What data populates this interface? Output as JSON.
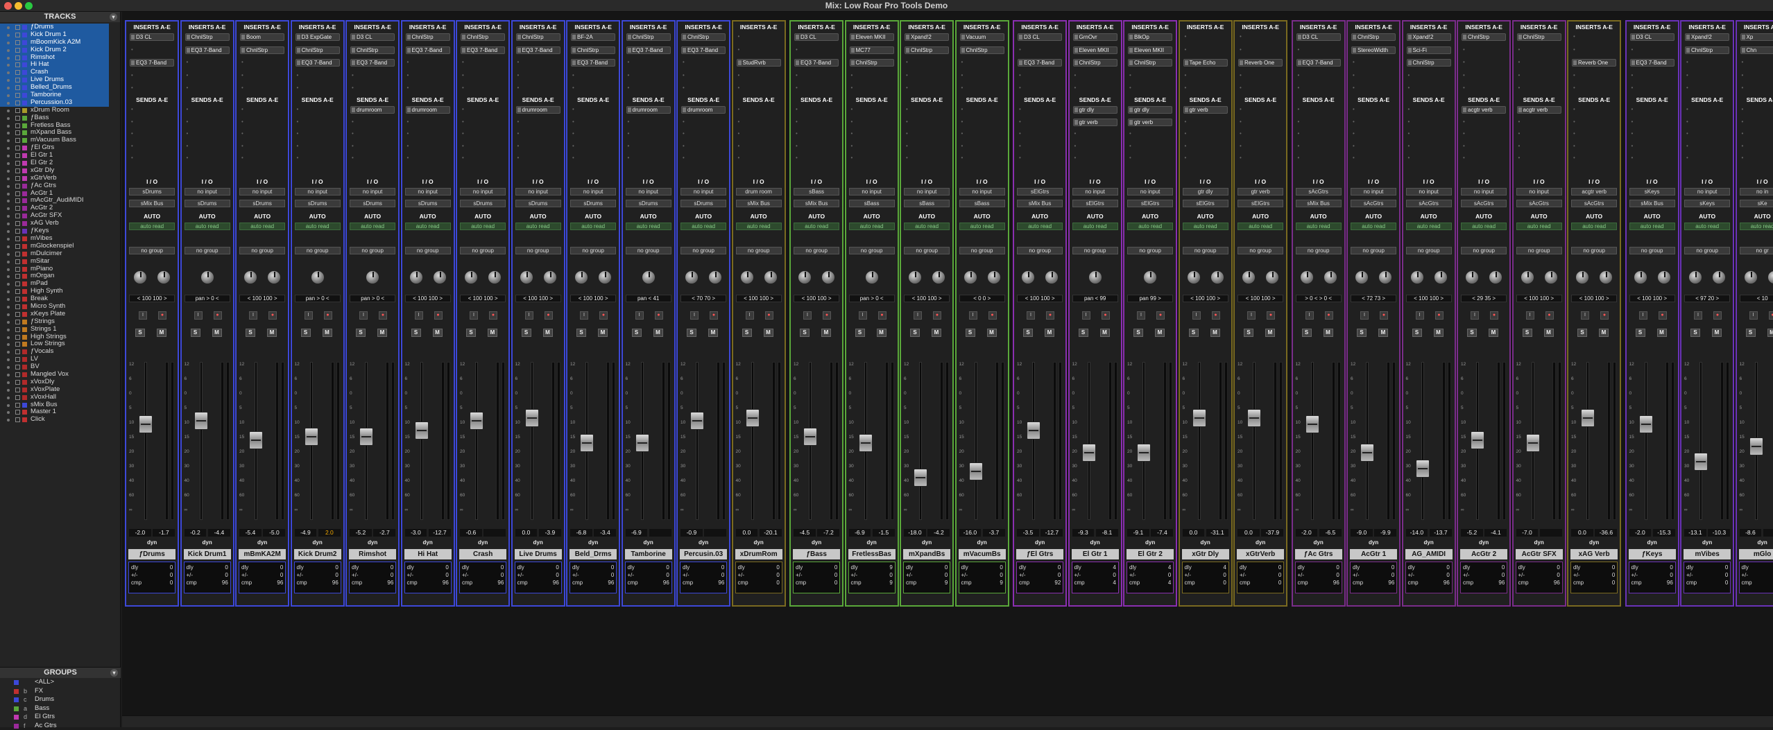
{
  "window": {
    "title": "Mix: Low Roar Pro Tools Demo"
  },
  "colors": {
    "drums": "#3d48d8",
    "bass": "#5aa83a",
    "elgtr": "#8a2fb0",
    "acgtr": "#7a2d8a",
    "keys": "#6a32b8",
    "aux": "#7a6a20",
    "teal": "#2a8a8a"
  },
  "sidebar": {
    "tracks_header": "TRACKS",
    "groups_header": "GROUPS",
    "tracks": [
      {
        "name": "ƒDrums",
        "color": "#3d48d8",
        "sel": true
      },
      {
        "name": "Kick Drum 1",
        "color": "#3d48d8",
        "sel": true
      },
      {
        "name": "mBoomKick A2M",
        "color": "#3d48d8",
        "sel": true
      },
      {
        "name": "Kick Drum 2",
        "color": "#3d48d8",
        "sel": true
      },
      {
        "name": "Rimshot",
        "color": "#3d48d8",
        "sel": true
      },
      {
        "name": "Hi Hat",
        "color": "#3d48d8",
        "sel": true
      },
      {
        "name": "Crash",
        "color": "#3d48d8",
        "sel": true
      },
      {
        "name": "Live Drums",
        "color": "#3d48d8",
        "sel": true
      },
      {
        "name": "Belled_Drums",
        "color": "#3d48d8",
        "sel": true
      },
      {
        "name": "Tamborine",
        "color": "#3d48d8",
        "sel": true
      },
      {
        "name": "Percussion.03",
        "color": "#3d48d8",
        "sel": true
      },
      {
        "name": "xDrum Room",
        "color": "#a89a2a",
        "sel": false
      },
      {
        "name": "ƒBass",
        "color": "#5aa83a",
        "sel": false
      },
      {
        "name": "Fretless Bass",
        "color": "#5aa83a",
        "sel": false
      },
      {
        "name": "mXpand Bass",
        "color": "#5aa83a",
        "sel": false
      },
      {
        "name": "mVacuum Bass",
        "color": "#5aa83a",
        "sel": false
      },
      {
        "name": "ƒEl Gtrs",
        "color": "#c03ab0",
        "sel": false
      },
      {
        "name": "El Gtr 1",
        "color": "#c03ab0",
        "sel": false
      },
      {
        "name": "El Gtr 2",
        "color": "#c03ab0",
        "sel": false
      },
      {
        "name": "xGtr Dly",
        "color": "#c03ab0",
        "sel": false
      },
      {
        "name": "xGtrVerb",
        "color": "#c03ab0",
        "sel": false
      },
      {
        "name": "ƒAc Gtrs",
        "color": "#9a2a9a",
        "sel": false
      },
      {
        "name": "AcGtr 1",
        "color": "#9a2a9a",
        "sel": false
      },
      {
        "name": "mAcGtr_AudiMIDI",
        "color": "#9a2a9a",
        "sel": false
      },
      {
        "name": "AcGtr 2",
        "color": "#9a2a9a",
        "sel": false
      },
      {
        "name": "AcGtr SFX",
        "color": "#9a2a9a",
        "sel": false
      },
      {
        "name": "xAG Verb",
        "color": "#9a2a9a",
        "sel": false
      },
      {
        "name": "ƒKeys",
        "color": "#6a32b8",
        "sel": false
      },
      {
        "name": "mVibes",
        "color": "#c03030",
        "sel": false
      },
      {
        "name": "mGlockenspiel",
        "color": "#c03030",
        "sel": false
      },
      {
        "name": "mDulcimer",
        "color": "#c03030",
        "sel": false
      },
      {
        "name": "mSitar",
        "color": "#c03030",
        "sel": false
      },
      {
        "name": "mPiano",
        "color": "#c03030",
        "sel": false
      },
      {
        "name": "mOrgan",
        "color": "#c03030",
        "sel": false
      },
      {
        "name": "mPad",
        "color": "#c03030",
        "sel": false
      },
      {
        "name": "High Synth",
        "color": "#c03030",
        "sel": false
      },
      {
        "name": "Break",
        "color": "#c03030",
        "sel": false
      },
      {
        "name": "Micro Synth",
        "color": "#c03030",
        "sel": false
      },
      {
        "name": "xKeys Plate",
        "color": "#c03030",
        "sel": false
      },
      {
        "name": "ƒStrings",
        "color": "#c07a20",
        "sel": false
      },
      {
        "name": "Strings 1",
        "color": "#c07a20",
        "sel": false
      },
      {
        "name": "High Strings",
        "color": "#c07a20",
        "sel": false
      },
      {
        "name": "Low Strings",
        "color": "#c07a20",
        "sel": false
      },
      {
        "name": "ƒVocals",
        "color": "#b02a2a",
        "sel": false
      },
      {
        "name": "LV",
        "color": "#b02a2a",
        "sel": false
      },
      {
        "name": "BV",
        "color": "#b02a2a",
        "sel": false
      },
      {
        "name": "Mangled Vox",
        "color": "#b02a2a",
        "sel": false
      },
      {
        "name": "xVoxDly",
        "color": "#b02a2a",
        "sel": false
      },
      {
        "name": "xVoxPlate",
        "color": "#b02a2a",
        "sel": false
      },
      {
        "name": "xVoxHall",
        "color": "#b02a2a",
        "sel": false
      },
      {
        "name": "sMix Bus",
        "color": "#3d48d8",
        "sel": false
      },
      {
        "name": "Master 1",
        "color": "#c03030",
        "sel": false
      },
      {
        "name": "Click",
        "color": "#c03030",
        "sel": false
      }
    ],
    "groups": [
      {
        "id": "",
        "name": "<ALL>",
        "color": "#3d48d8"
      },
      {
        "id": "b",
        "name": "FX",
        "color": "#c03030"
      },
      {
        "id": "c",
        "name": "Drums",
        "color": "#3d48d8"
      },
      {
        "id": "a",
        "name": "Bass",
        "color": "#5aa83a"
      },
      {
        "id": "d",
        "name": "El Gtrs",
        "color": "#c03ab0"
      },
      {
        "id": "f",
        "name": "Ac Gtrs",
        "color": "#9a2a9a"
      }
    ]
  },
  "strips": [
    {
      "name": "ƒDrums",
      "color": "#3d48d8",
      "ins": [
        "D3 CL",
        "",
        "EQ3 7-Band"
      ],
      "sends": [],
      "io_in": "sDrums",
      "io_out": "sMix Bus",
      "group": "no group",
      "pan": [
        "< 100",
        "100 >"
      ],
      "stereo": true,
      "vol": "-2.0",
      "peak": "-1.7",
      "fpos": 0.42,
      "dly": "0",
      "pm": "0",
      "cmp": "0"
    },
    {
      "name": "Kick Drum1",
      "color": "#3d48d8",
      "ins": [
        "ChnlStrp",
        "EQ3 7-Band",
        ""
      ],
      "sends": [],
      "io_in": "no input",
      "io_out": "sDrums",
      "group": "no group",
      "pan": [
        "pan",
        "> 0 <"
      ],
      "stereo": false,
      "vol": "-0.2",
      "peak": "-4.4",
      "fpos": 0.4,
      "dly": "0",
      "pm": "0",
      "cmp": "96"
    },
    {
      "name": "mBmKA2M",
      "color": "#3d48d8",
      "ins": [
        "Boom",
        "ChnlStrp",
        ""
      ],
      "sends": [],
      "io_in": "no input",
      "io_out": "sDrums",
      "group": "no group",
      "pan": [
        "< 100",
        "100 >"
      ],
      "stereo": true,
      "vol": "-5.4",
      "peak": "-5.0",
      "fpos": 0.52,
      "dly": "0",
      "pm": "0",
      "cmp": "96"
    },
    {
      "name": "Kick Drum2",
      "color": "#3d48d8",
      "ins": [
        "D3 ExpGate",
        "ChnlStrp",
        "EQ3 7-Band"
      ],
      "sends": [],
      "io_in": "no input",
      "io_out": "sDrums",
      "group": "no group",
      "pan": [
        "pan",
        "> 0 <"
      ],
      "stereo": false,
      "vol": "-4.9",
      "peak": "2.0",
      "fpos": 0.5,
      "dly": "0",
      "pm": "0",
      "cmp": "96"
    },
    {
      "name": "Rimshot",
      "color": "#3d48d8",
      "ins": [
        "D3 CL",
        "ChnlStrp",
        "EQ3 7-Band"
      ],
      "sends": [
        "drumroom"
      ],
      "io_in": "no input",
      "io_out": "sDrums",
      "group": "no group",
      "pan": [
        "pan",
        "> 0 <"
      ],
      "stereo": false,
      "vol": "-5.2",
      "peak": "-2.7",
      "fpos": 0.5,
      "dly": "0",
      "pm": "0",
      "cmp": "96"
    },
    {
      "name": "Hi Hat",
      "color": "#3d48d8",
      "ins": [
        "ChnlStrp",
        "EQ3 7-Band",
        ""
      ],
      "sends": [
        "drumroom"
      ],
      "io_in": "no input",
      "io_out": "sDrums",
      "group": "no group",
      "pan": [
        "< 100",
        "100 >"
      ],
      "stereo": true,
      "vol": "-3.0",
      "peak": "-12.7",
      "fpos": 0.46,
      "dly": "0",
      "pm": "0",
      "cmp": "96"
    },
    {
      "name": "Crash",
      "color": "#3d48d8",
      "ins": [
        "ChnlStrp",
        "EQ3 7-Band",
        ""
      ],
      "sends": [],
      "io_in": "no input",
      "io_out": "sDrums",
      "group": "no group",
      "pan": [
        "< 100",
        "100 >"
      ],
      "stereo": true,
      "vol": "-0.6",
      "peak": "",
      "fpos": 0.4,
      "dly": "0",
      "pm": "0",
      "cmp": "96"
    },
    {
      "name": "Live Drums",
      "color": "#3d48d8",
      "ins": [
        "ChnlStrp",
        "EQ3 7-Band",
        ""
      ],
      "sends": [
        "drumroom"
      ],
      "io_in": "no input",
      "io_out": "sDrums",
      "group": "no group",
      "pan": [
        "< 100",
        "100 >"
      ],
      "stereo": true,
      "vol": "0.0",
      "peak": "-3.9",
      "fpos": 0.38,
      "dly": "0",
      "pm": "0",
      "cmp": "96"
    },
    {
      "name": "Beld_Drms",
      "color": "#3d48d8",
      "ins": [
        "BF-2A",
        "ChnlStrp",
        "EQ3 7-Band"
      ],
      "sends": [],
      "io_in": "no input",
      "io_out": "sDrums",
      "group": "no group",
      "pan": [
        "< 100",
        "100 >"
      ],
      "stereo": true,
      "vol": "-6.8",
      "peak": "-3.4",
      "fpos": 0.54,
      "dly": "0",
      "pm": "0",
      "cmp": "96"
    },
    {
      "name": "Tamborine",
      "color": "#3d48d8",
      "ins": [
        "ChnlStrp",
        "EQ3 7-Band",
        ""
      ],
      "sends": [
        "drumroom"
      ],
      "io_in": "no input",
      "io_out": "sDrums",
      "group": "no group",
      "pan": [
        "pan",
        "< 41"
      ],
      "stereo": false,
      "vol": "-6.9",
      "peak": "",
      "fpos": 0.54,
      "dly": "0",
      "pm": "0",
      "cmp": "96"
    },
    {
      "name": "Percusin.03",
      "color": "#3d48d8",
      "ins": [
        "ChnlStrp",
        "EQ3 7-Band",
        ""
      ],
      "sends": [
        "drumroom"
      ],
      "io_in": "no input",
      "io_out": "sDrums",
      "group": "no group",
      "pan": [
        "< 70",
        "70 >"
      ],
      "stereo": true,
      "vol": "-0.9",
      "peak": "",
      "fpos": 0.4,
      "dly": "0",
      "pm": "0",
      "cmp": "96"
    },
    {
      "name": "xDrumRom",
      "color": "#7a6a20",
      "ins": [
        "",
        "",
        "StudRvrb"
      ],
      "sends": [],
      "io_in": "drum room",
      "io_out": "sMix Bus",
      "group": "no group",
      "pan": [
        "< 100",
        "100 >"
      ],
      "stereo": true,
      "vol": "0.0",
      "peak": "-20.1",
      "fpos": 0.38,
      "dly": "0",
      "pm": "0",
      "cmp": "0"
    },
    {
      "name": "ƒBass",
      "color": "#5aa83a",
      "ins": [
        "D3 CL",
        "",
        "EQ3 7-Band"
      ],
      "sends": [],
      "io_in": "sBass",
      "io_out": "sMix Bus",
      "group": "no group",
      "pan": [
        "< 100",
        "100 >"
      ],
      "stereo": true,
      "vol": "-4.5",
      "peak": "-7.2",
      "fpos": 0.5,
      "dly": "0",
      "pm": "0",
      "cmp": "0"
    },
    {
      "name": "FretlessBas",
      "color": "#5aa83a",
      "ins": [
        "Eleven MKII",
        "MC77",
        "ChnlStrp"
      ],
      "sends": [],
      "io_in": "no input",
      "io_out": "sBass",
      "group": "no group",
      "pan": [
        "pan",
        "> 0 <"
      ],
      "stereo": false,
      "vol": "-6.9",
      "peak": "-1.5",
      "fpos": 0.54,
      "dly": "9",
      "pm": "0",
      "cmp": "9"
    },
    {
      "name": "mXpandBs",
      "color": "#5aa83a",
      "ins": [
        "Xpand!2",
        "ChnlStrp",
        ""
      ],
      "sends": [],
      "io_in": "no input",
      "io_out": "sBass",
      "group": "no group",
      "pan": [
        "< 100",
        "100 >"
      ],
      "stereo": true,
      "vol": "-18.0",
      "peak": "-4.2",
      "fpos": 0.76,
      "dly": "0",
      "pm": "0",
      "cmp": "9"
    },
    {
      "name": "mVacumBs",
      "color": "#5aa83a",
      "ins": [
        "Vacuum",
        "ChnlStrp",
        ""
      ],
      "sends": [],
      "io_in": "no input",
      "io_out": "sBass",
      "group": "no group",
      "pan": [
        "< 0",
        "0 >"
      ],
      "stereo": true,
      "vol": "-16.0",
      "peak": "-3.7",
      "fpos": 0.72,
      "dly": "0",
      "pm": "0",
      "cmp": "9"
    },
    {
      "name": "ƒEl Gtrs",
      "color": "#8a2fb0",
      "ins": [
        "D3 CL",
        "",
        "EQ3 7-Band"
      ],
      "sends": [],
      "io_in": "sElGtrs",
      "io_out": "sMix Bus",
      "group": "no group",
      "pan": [
        "< 100",
        "100 >"
      ],
      "stereo": true,
      "vol": "-3.5",
      "peak": "-12.7",
      "fpos": 0.46,
      "dly": "0",
      "pm": "0",
      "cmp": "92"
    },
    {
      "name": "El Gtr 1",
      "color": "#8a2fb0",
      "ins": [
        "GrnOvr",
        "Eleven MKII",
        "ChnlStrp"
      ],
      "sends": [
        "gtr dly",
        "gtr verb"
      ],
      "io_in": "no input",
      "io_out": "sElGtrs",
      "group": "no group",
      "pan": [
        "pan",
        "< 99"
      ],
      "stereo": false,
      "vol": "-9.3",
      "peak": "-8.1",
      "fpos": 0.6,
      "dly": "4",
      "pm": "0",
      "cmp": "4"
    },
    {
      "name": "El Gtr 2",
      "color": "#8a2fb0",
      "ins": [
        "BlkOp",
        "Eleven MKII",
        "ChnlStrp"
      ],
      "sends": [
        "gtr dly",
        "gtr verb"
      ],
      "io_in": "no input",
      "io_out": "sElGtrs",
      "group": "no group",
      "pan": [
        "pan",
        "99 >"
      ],
      "stereo": false,
      "vol": "-9.1",
      "peak": "-7.4",
      "fpos": 0.6,
      "dly": "4",
      "pm": "0",
      "cmp": "4"
    },
    {
      "name": "xGtr Dly",
      "color": "#7a6a20",
      "ins": [
        "",
        "",
        "Tape Echo"
      ],
      "sends": [
        "gtr verb"
      ],
      "io_in": "gtr dly",
      "io_out": "sElGtrs",
      "group": "no group",
      "pan": [
        "< 100",
        "100 >"
      ],
      "stereo": true,
      "vol": "0.0",
      "peak": "-31.1",
      "fpos": 0.38,
      "dly": "4",
      "pm": "0",
      "cmp": "0"
    },
    {
      "name": "xGtrVerb",
      "color": "#7a6a20",
      "ins": [
        "",
        "",
        "Reverb One"
      ],
      "sends": [],
      "io_in": "gtr verb",
      "io_out": "sElGtrs",
      "group": "no group",
      "pan": [
        "< 100",
        "100 >"
      ],
      "stereo": true,
      "vol": "0.0",
      "peak": "-37.9",
      "fpos": 0.38,
      "dly": "0",
      "pm": "0",
      "cmp": "0"
    },
    {
      "name": "ƒAc Gtrs",
      "color": "#7a2d8a",
      "ins": [
        "D3 CL",
        "",
        "EQ3 7-Band"
      ],
      "sends": [],
      "io_in": "sAcGtrs",
      "io_out": "sMix Bus",
      "group": "no group",
      "pan": [
        "> 0 <",
        "> 0 <"
      ],
      "stereo": true,
      "vol": "-2.0",
      "peak": "-6.5",
      "fpos": 0.42,
      "dly": "0",
      "pm": "0",
      "cmp": "96"
    },
    {
      "name": "AcGtr 1",
      "color": "#7a2d8a",
      "ins": [
        "ChnlStrp",
        "StereoWidth",
        ""
      ],
      "sends": [],
      "io_in": "no input",
      "io_out": "sAcGtrs",
      "group": "no group",
      "pan": [
        "< 72",
        "73 >"
      ],
      "stereo": true,
      "vol": "-9.0",
      "peak": "-9.9",
      "fpos": 0.6,
      "dly": "0",
      "pm": "0",
      "cmp": "96"
    },
    {
      "name": "AG_AMIDI",
      "color": "#7a2d8a",
      "ins": [
        "Xpand!2",
        "Sci-Fi",
        "ChnlStrp"
      ],
      "sends": [],
      "io_in": "no input",
      "io_out": "sAcGtrs",
      "group": "no group",
      "pan": [
        "< 100",
        "100 >"
      ],
      "stereo": true,
      "vol": "-14.0",
      "peak": "-13.7",
      "fpos": 0.7,
      "dly": "0",
      "pm": "0",
      "cmp": "96"
    },
    {
      "name": "AcGtr 2",
      "color": "#7a2d8a",
      "ins": [
        "ChnlStrp",
        "",
        ""
      ],
      "sends": [
        "acgtr verb"
      ],
      "io_in": "no input",
      "io_out": "sAcGtrs",
      "group": "no group",
      "pan": [
        "< 29",
        "35 >"
      ],
      "stereo": true,
      "vol": "-5.2",
      "peak": "-4.1",
      "fpos": 0.52,
      "dly": "0",
      "pm": "0",
      "cmp": "96"
    },
    {
      "name": "AcGtr SFX",
      "color": "#7a2d8a",
      "ins": [
        "ChnlStrp",
        "",
        ""
      ],
      "sends": [
        "acgtr verb"
      ],
      "io_in": "no input",
      "io_out": "sAcGtrs",
      "group": "no group",
      "pan": [
        "< 100",
        "100 >"
      ],
      "stereo": true,
      "vol": "-7.0",
      "peak": "",
      "fpos": 0.54,
      "dly": "0",
      "pm": "0",
      "cmp": "96"
    },
    {
      "name": "xAG Verb",
      "color": "#7a6a20",
      "ins": [
        "",
        "",
        "Reverb One"
      ],
      "sends": [],
      "io_in": "acgtr verb",
      "io_out": "sAcGtrs",
      "group": "no group",
      "pan": [
        "< 100",
        "100 >"
      ],
      "stereo": true,
      "vol": "0.0",
      "peak": "-36.6",
      "fpos": 0.38,
      "dly": "0",
      "pm": "0",
      "cmp": "0"
    },
    {
      "name": "ƒKeys",
      "color": "#6a32b8",
      "ins": [
        "D3 CL",
        "",
        "EQ3 7-Band"
      ],
      "sends": [],
      "io_in": "sKeys",
      "io_out": "sMix Bus",
      "group": "no group",
      "pan": [
        "< 100",
        "100 >"
      ],
      "stereo": true,
      "vol": "-2.0",
      "peak": "-15.3",
      "fpos": 0.42,
      "dly": "0",
      "pm": "0",
      "cmp": "96"
    },
    {
      "name": "mVibes",
      "color": "#6a32b8",
      "ins": [
        "Xpand!2",
        "ChnlStrp",
        ""
      ],
      "sends": [],
      "io_in": "no input",
      "io_out": "sKeys",
      "group": "no group",
      "pan": [
        "< 97",
        "20 >"
      ],
      "stereo": true,
      "vol": "-13.1",
      "peak": "-10.3",
      "fpos": 0.66,
      "dly": "0",
      "pm": "0",
      "cmp": "0"
    },
    {
      "name": "mGlo",
      "color": "#6a32b8",
      "ins": [
        "Xp",
        "Chn",
        ""
      ],
      "sends": [],
      "io_in": "no in",
      "io_out": "sKe",
      "group": "no gr",
      "pan": [
        "< 10",
        ""
      ],
      "stereo": true,
      "vol": "-8.6",
      "peak": "",
      "fpos": 0.56,
      "dly": "0",
      "pm": "0",
      "cmp": "0"
    }
  ],
  "labels": {
    "inserts": "INSERTS A-E",
    "sends": "SENDS A-E",
    "io": "I / O",
    "auto": "AUTO",
    "auto_mode": "auto read",
    "dly": "dly",
    "pm": "+/-",
    "cmp": "cmp",
    "dyn": "dyn",
    "input_btn": "I",
    "solo": "S",
    "mute": "M"
  },
  "fader_scale": [
    "12",
    "6",
    "0",
    "5",
    "10",
    "15",
    "20",
    "30",
    "40",
    "60",
    "∞"
  ]
}
